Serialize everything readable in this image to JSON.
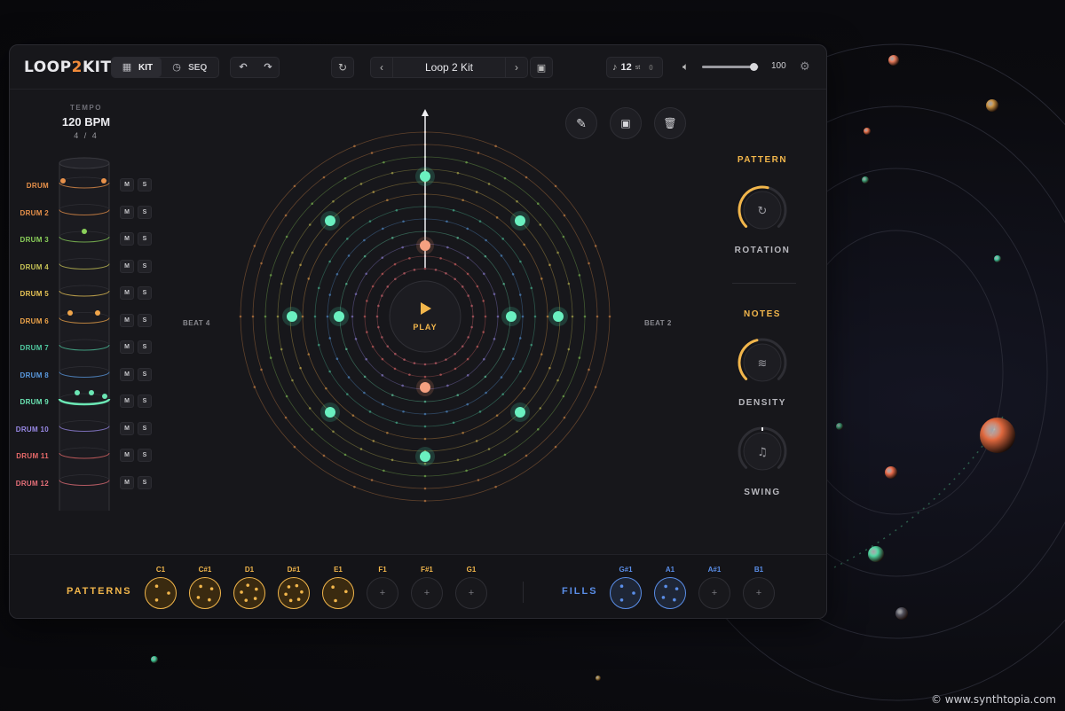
{
  "app": {
    "logo_prefix": "LOOP",
    "logo_num": "2",
    "logo_suffix": "KIT",
    "tabs": [
      {
        "label": "KIT",
        "icon": "grid-icon"
      },
      {
        "label": "SEQ",
        "icon": "clock-icon"
      }
    ],
    "kit_name": "Loop 2 Kit",
    "steps": "12",
    "steps_unit": "st",
    "steps_extra": "0",
    "volume": "100",
    "volume_level": 0.9
  },
  "left_panel": {
    "tempo_label": "TEMPO",
    "bpm": "120 BPM",
    "time_signature": "4 / 4",
    "mute_label": "M",
    "solo_label": "S",
    "drums": [
      {
        "name": "DRUM",
        "color": "#e8914a"
      },
      {
        "name": "DRUM 2",
        "color": "#e8914a"
      },
      {
        "name": "DRUM 3",
        "color": "#8bd05a"
      },
      {
        "name": "DRUM 4",
        "color": "#c8c456"
      },
      {
        "name": "DRUM 5",
        "color": "#e8c455"
      },
      {
        "name": "DRUM 6",
        "color": "#f0a54a"
      },
      {
        "name": "DRUM 7",
        "color": "#4fc9a0"
      },
      {
        "name": "DRUM 8",
        "color": "#5a9ae0"
      },
      {
        "name": "DRUM 9",
        "color": "#6be6b4"
      },
      {
        "name": "DRUM 10",
        "color": "#9a8ae8"
      },
      {
        "name": "DRUM 11",
        "color": "#e86a6a"
      },
      {
        "name": "DRUM 12",
        "color": "#e8707a"
      }
    ]
  },
  "sequencer": {
    "play_label": "PLAY",
    "beat_left": "BEAT 4",
    "beat_right": "BEAT 2",
    "toolbar": [
      {
        "icon": "pencil-icon"
      },
      {
        "icon": "save-icon"
      },
      {
        "icon": "trash-icon"
      }
    ]
  },
  "right_panel": {
    "pattern_title": "PATTERN",
    "rotation_label": "ROTATION",
    "rotation_value": 0.55,
    "notes_title": "NOTES",
    "density_label": "DENSITY",
    "density_value": 0.45,
    "swing_label": "SWING",
    "swing_value": 0.5,
    "accent_color": "#f2b64b"
  },
  "bottom": {
    "patterns_title": "PATTERNS",
    "fills_title": "FILLS",
    "patterns": [
      {
        "label": "C1",
        "filled": true
      },
      {
        "label": "C#1",
        "filled": true
      },
      {
        "label": "D1",
        "filled": true
      },
      {
        "label": "D#1",
        "filled": true
      },
      {
        "label": "E1",
        "filled": true
      },
      {
        "label": "F1",
        "filled": false
      },
      {
        "label": "F#1",
        "filled": false
      },
      {
        "label": "G1",
        "filled": false
      }
    ],
    "fills": [
      {
        "label": "G#1",
        "filled": true
      },
      {
        "label": "A1",
        "filled": true
      },
      {
        "label": "A#1",
        "filled": false
      },
      {
        "label": "B1",
        "filled": false
      }
    ],
    "add_symbol": "+"
  },
  "watermark": "© www.synthtopia.com"
}
